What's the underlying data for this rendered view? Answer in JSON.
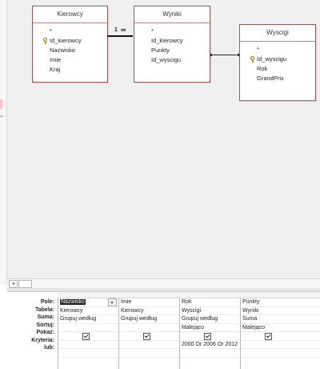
{
  "tables": [
    {
      "id": "kierowcy",
      "title": "Kierowcy",
      "fields": [
        "*",
        "Id_kierowcy",
        "Nazwisko",
        "Imie",
        "Kraj"
      ],
      "key_field": "Id_kierowcy"
    },
    {
      "id": "wyniki",
      "title": "Wyniki",
      "fields": [
        "*",
        "Id_kierowcy",
        "Punkty",
        "Id_wyscigu"
      ],
      "key_field": ""
    },
    {
      "id": "wyscigi",
      "title": "Wyscigi",
      "fields": [
        "*",
        "Id_wyscigu",
        "Rok",
        "GrandPrix"
      ],
      "key_field": "Id_wyscigu"
    }
  ],
  "relationship": {
    "one_label": "1",
    "many_label": "∞"
  },
  "grid": {
    "row_labels": [
      "Pole:",
      "Tabela:",
      "Suma:",
      "Sortuj:",
      "Pokaż:",
      "Kryteria:",
      "lub:"
    ],
    "columns": [
      {
        "pole": "Nazwisko",
        "tabela": "Kierowcy",
        "suma": "Grupuj według",
        "sortuj": "",
        "pokaz": true,
        "kryteria": "",
        "lub": ""
      },
      {
        "pole": "Imie",
        "tabela": "Kierowcy",
        "suma": "Grupuj według",
        "sortuj": "",
        "pokaz": true,
        "kryteria": "",
        "lub": ""
      },
      {
        "pole": "Rok",
        "tabela": "Wyscigi",
        "suma": "Grupuj według",
        "sortuj": "Malejąco",
        "pokaz": true,
        "kryteria": "2000 Or 2006 Or 2012",
        "lub": ""
      },
      {
        "pole": "Punkty",
        "tabela": "Wyniki",
        "suma": "Suma",
        "sortuj": "Malejąco",
        "pokaz": true,
        "kryteria": "",
        "lub": ""
      }
    ]
  },
  "colors": {
    "table_border": "#9b5a5a",
    "background": "#f0f0f0"
  }
}
